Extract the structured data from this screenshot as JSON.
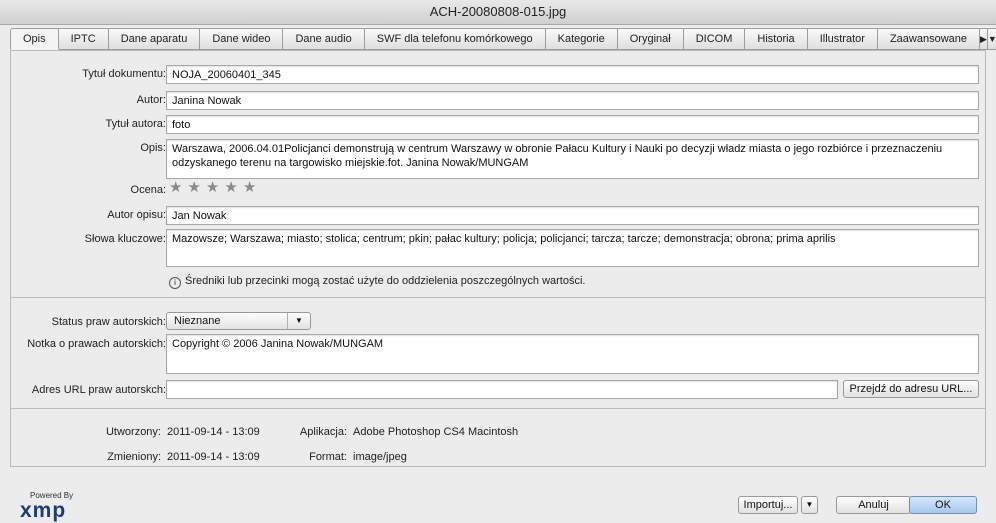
{
  "window": {
    "title": "ACH-20080808-015.jpg"
  },
  "tabs": [
    {
      "label": "Opis",
      "active": true
    },
    {
      "label": "IPTC"
    },
    {
      "label": "Dane aparatu"
    },
    {
      "label": "Dane wideo"
    },
    {
      "label": "Dane audio"
    },
    {
      "label": "SWF dla telefonu komórkowego"
    },
    {
      "label": "Kategorie"
    },
    {
      "label": "Oryginał"
    },
    {
      "label": "DICOM"
    },
    {
      "label": "Historia"
    },
    {
      "label": "Illustrator"
    },
    {
      "label": "Zaawansowane"
    }
  ],
  "tab_scroll": {
    "right_icon": "play-right-icon",
    "menu_icon": "chevron-down-icon"
  },
  "form": {
    "doc_title_label": "Tytuł dokumentu:",
    "doc_title_value": "NOJA_20060401_345",
    "author_label": "Autor:",
    "author_value": "Janina Nowak",
    "author_title_label": "Tytuł autora:",
    "author_title_value": "foto",
    "description_label": "Opis:",
    "description_value": "Warszawa, 2006.04.01Policjanci demonstrują w centrum Warszawy w obronie Pałacu Kultury i Nauki po decyzji władz miasta o jego rozbiórce i przeznaczeniu odzyskanego terenu na targowisko miejskie.fot. Janina Nowak/MUNGAM",
    "rating_label": "Ocena:",
    "rating_value": 0,
    "rating_max": 5,
    "desc_author_label": "Autor opisu:",
    "desc_author_value": "Jan Nowak",
    "keywords_label": "Słowa kluczowe:",
    "keywords_value": "Mazowsze; Warszawa; miasto; stolica; centrum; pkin; pałac kultury; policja; policjanci; tarcza; tarcze; demonstracja; obrona; prima aprilis",
    "hint": "Średniki lub przecinki mogą zostać użyte do oddzielenia poszczególnych wartości."
  },
  "copyright": {
    "status_label": "Status praw autorskich:",
    "status_value": "Nieznane",
    "notice_label": "Notka o prawach autorskich:",
    "notice_value": "Copyright © 2006 Janina Nowak/MUNGAM",
    "url_label": "Adres URL praw autorskch:",
    "url_value": "",
    "goto_button": "Przejdź do adresu URL..."
  },
  "meta": {
    "created_label": "Utworzony:",
    "created_value": "2011-09-14 - 13:09",
    "modified_label": "Zmieniony:",
    "modified_value": "2011-09-14 - 13:09",
    "app_label": "Aplikacja:",
    "app_value": "Adobe Photoshop CS4 Macintosh",
    "format_label": "Format:",
    "format_value": "image/jpeg"
  },
  "footer": {
    "powered_by": "Powered By",
    "logo": "xmp",
    "import_button": "Importuj...",
    "cancel_button": "Anuluj",
    "ok_button": "OK"
  }
}
